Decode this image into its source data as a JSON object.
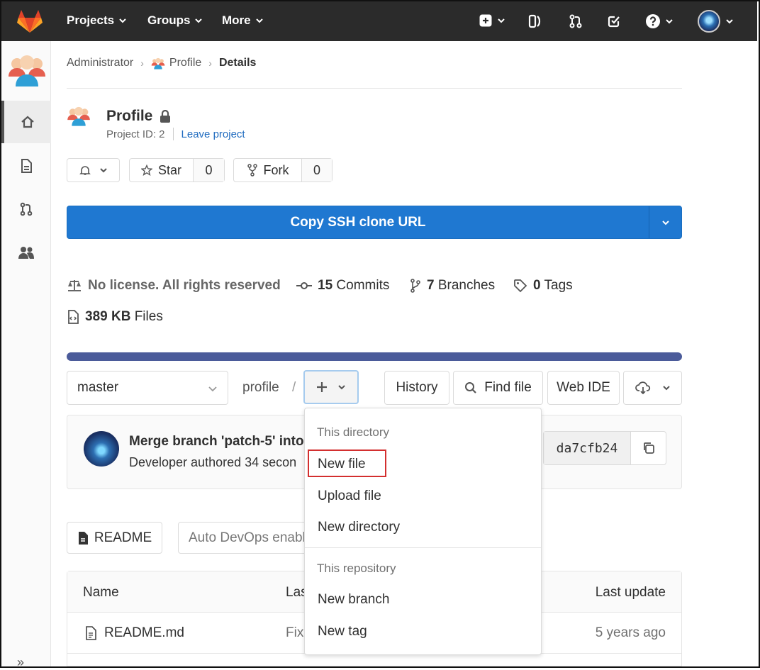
{
  "topnav": {
    "projects": "Projects",
    "groups": "Groups",
    "more": "More"
  },
  "breadcrumb": {
    "root": "Administrator",
    "project": "Profile",
    "current": "Details"
  },
  "project": {
    "name": "Profile",
    "id_label": "Project ID: 2",
    "leave_link": "Leave project"
  },
  "actions": {
    "star_label": "Star",
    "star_count": "0",
    "fork_label": "Fork",
    "fork_count": "0"
  },
  "clone": {
    "label": "Copy SSH clone URL"
  },
  "stats": {
    "license": "No license. All rights reserved",
    "commits_count": "15",
    "commits_label": "Commits",
    "branches_count": "7",
    "branches_label": "Branches",
    "tags_count": "0",
    "tags_label": "Tags",
    "files_size": "389 KB",
    "files_label": "Files"
  },
  "tree": {
    "branch": "master",
    "path_root": "profile",
    "path_sep": "/",
    "history": "History",
    "find_file": "Find file",
    "web_ide": "Web IDE"
  },
  "commit": {
    "title": "Merge branch 'patch-5' into",
    "subtitle": "Developer authored 34 secon",
    "sha": "da7cfb24"
  },
  "readme": {
    "button": "README",
    "auto_devops": "Auto DevOps enabled"
  },
  "table": {
    "col_name": "Name",
    "col_last_commit": "Last commit",
    "col_last_update": "Last update",
    "rows": [
      {
        "name": "README.md",
        "commit": "Fix",
        "updated": "5 years ago"
      }
    ]
  },
  "dropdown": {
    "header_directory": "This directory",
    "new_file": "New file",
    "upload_file": "Upload file",
    "new_directory": "New directory",
    "header_repository": "This repository",
    "new_branch": "New branch",
    "new_tag": "New tag"
  },
  "colors": {
    "navbar": "#2b2b2b",
    "primary": "#1f78d1",
    "link": "#1f6bbf",
    "highlight": "#d32f2f",
    "progress": "#4b5b9a"
  }
}
